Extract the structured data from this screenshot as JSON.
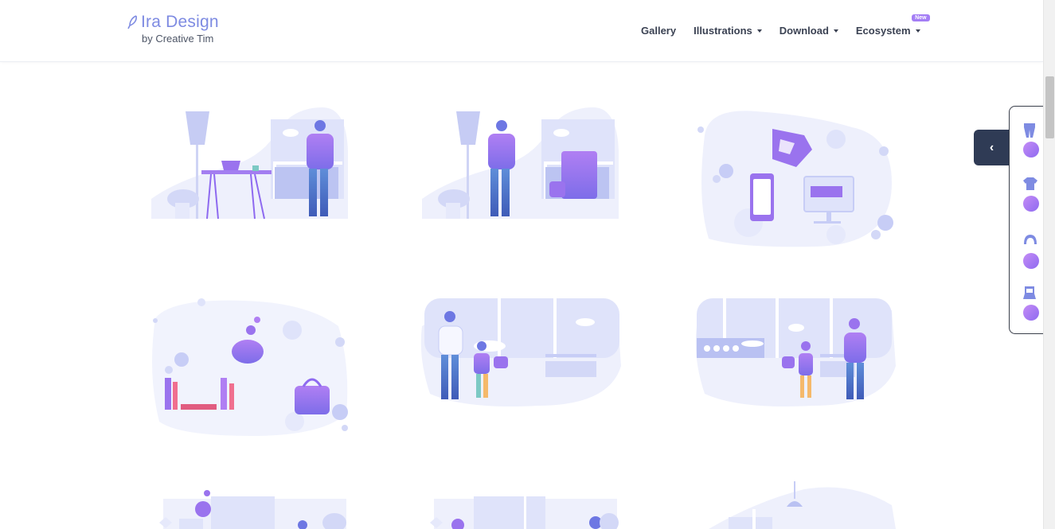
{
  "brand": {
    "title": "Ira Design",
    "subtitle": "by Creative Tim"
  },
  "nav": {
    "items": [
      {
        "label": "Gallery"
      },
      {
        "label": "Illustrations"
      },
      {
        "label": "Download"
      },
      {
        "label": "Ecosystem",
        "badge": "New"
      }
    ]
  },
  "side_panel": {
    "toggle_icon": "chevron-left-icon",
    "items": [
      {
        "icon": "pants-icon"
      },
      {
        "icon": "shirt-icon"
      },
      {
        "icon": "hair-icon"
      },
      {
        "icon": "shoes-icon"
      }
    ]
  },
  "colors": {
    "accent": "#7e8be2",
    "purple": "#8e6af0",
    "panel_button": "#2f3b55",
    "badge": "#a47ef5"
  },
  "gallery": {
    "illustrations": [
      {
        "icon": "man-at-desk-illustration"
      },
      {
        "icon": "man-with-luggage-illustration"
      },
      {
        "icon": "devices-illustration"
      },
      {
        "icon": "savings-illustration"
      },
      {
        "icon": "father-and-son-illustration"
      },
      {
        "icon": "mother-and-daughter-illustration"
      },
      {
        "icon": "bank-illustration"
      },
      {
        "icon": "office-illustration"
      },
      {
        "icon": "lamp-room-illustration"
      }
    ]
  }
}
